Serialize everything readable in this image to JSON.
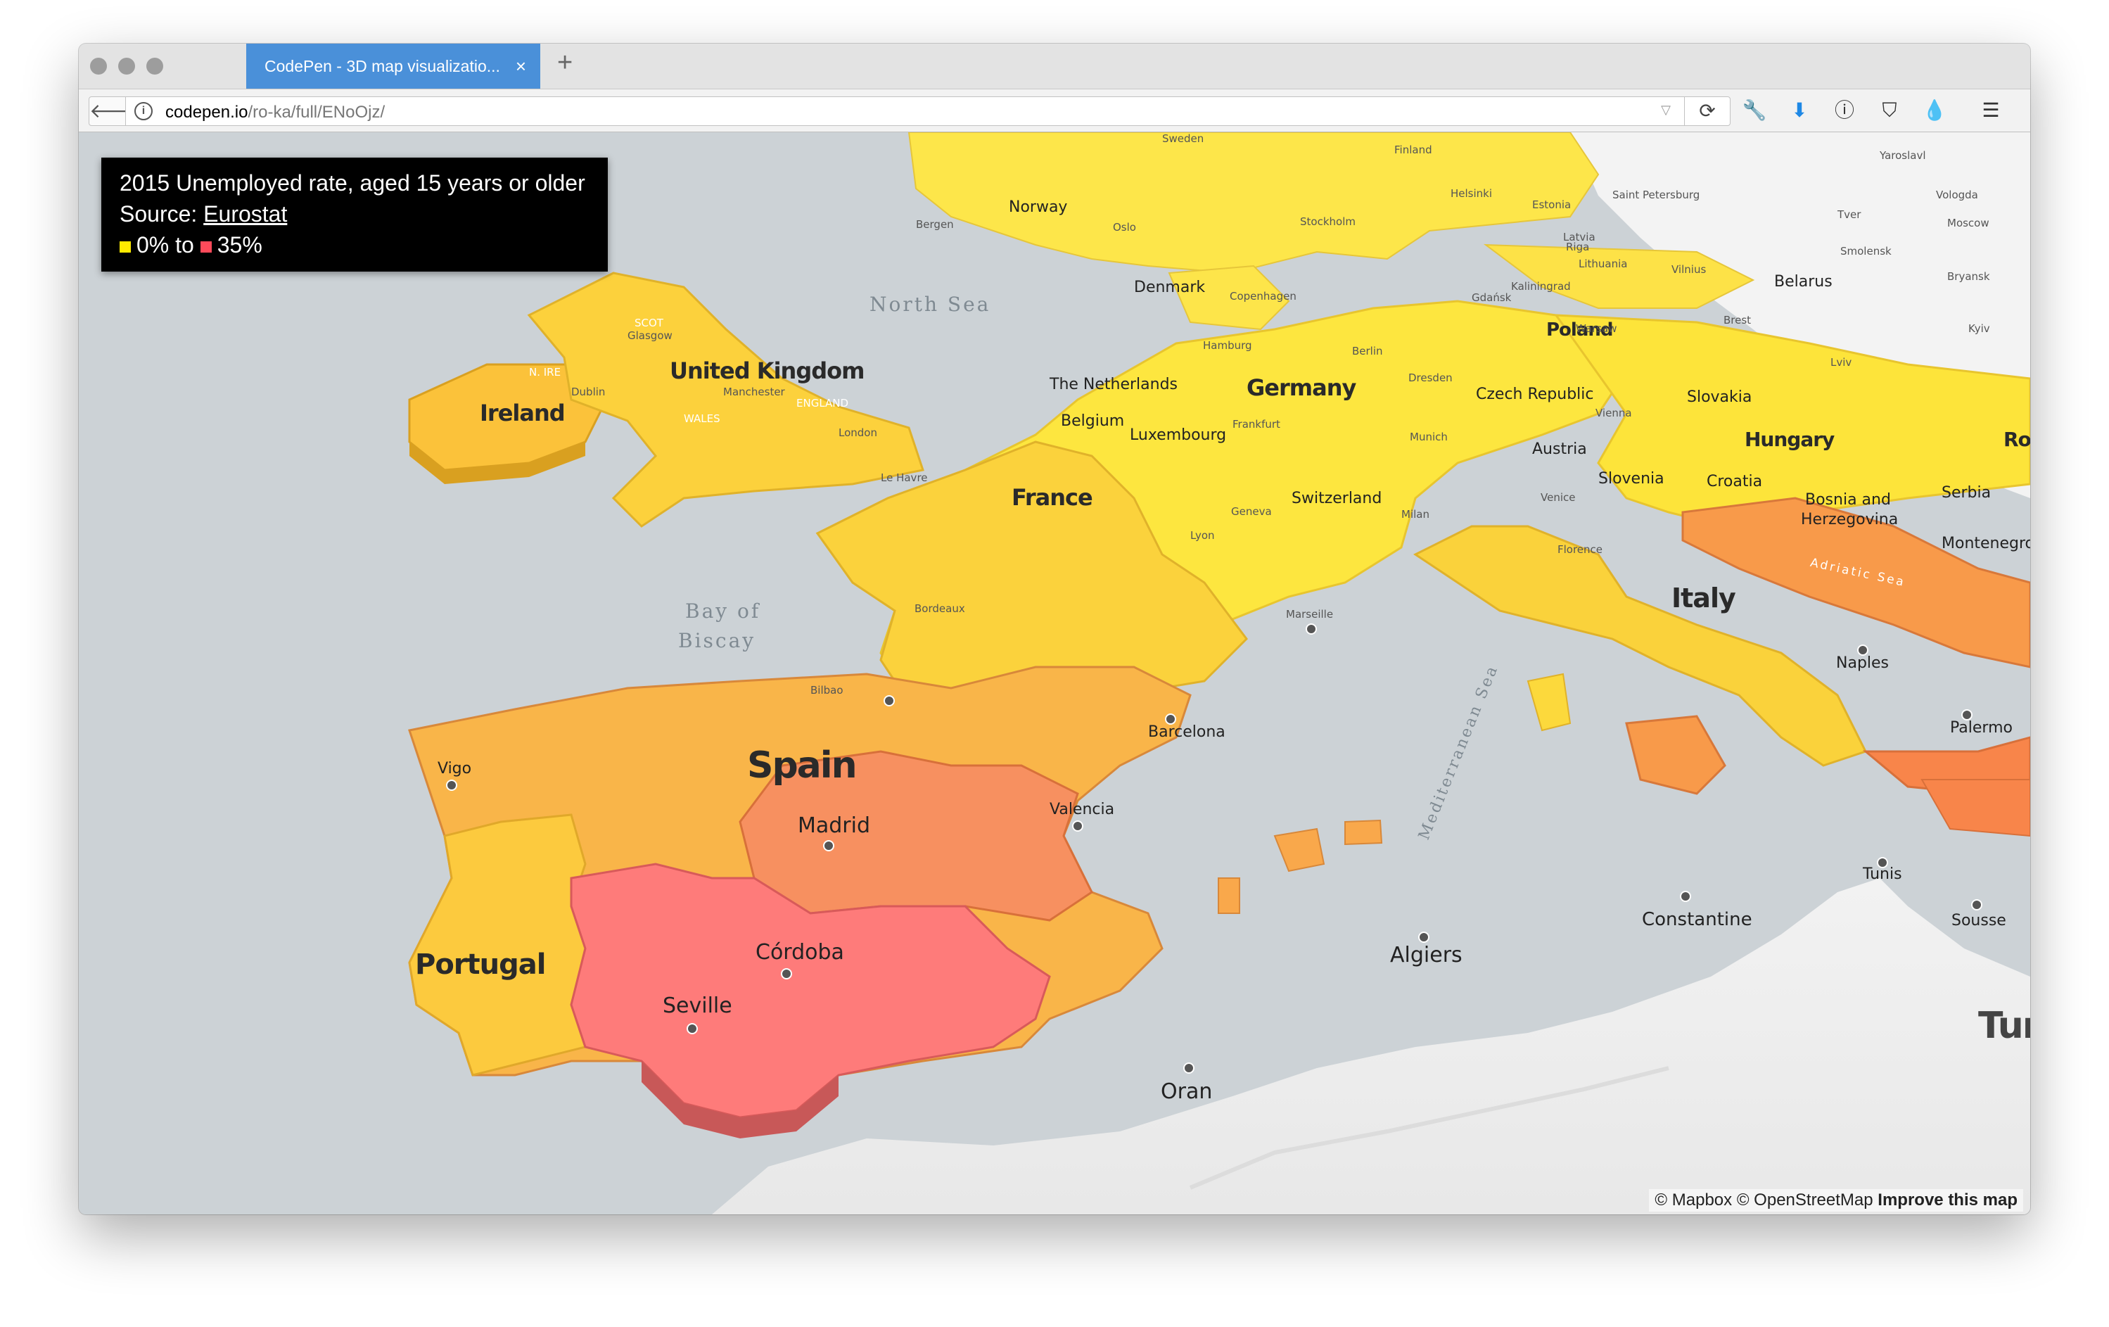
{
  "browser": {
    "tab_title": "CodePen - 3D map visualizatio...",
    "tab_close": "×",
    "new_tab": "+",
    "url_host": "codepen.io",
    "url_path": "/ro-ka/full/ENoOjz/",
    "back": "🡐",
    "info": "i",
    "dropdown": "▽",
    "reload": "⟳",
    "toolbar_icons": [
      {
        "name": "wrench-icon",
        "glyph": "🔧"
      },
      {
        "name": "download-icon",
        "glyph": "⬇"
      },
      {
        "name": "onepassword-icon",
        "glyph": "ⓘ"
      },
      {
        "name": "ublock-icon",
        "glyph": "⛉"
      },
      {
        "name": "drop-icon",
        "glyph": "💧"
      },
      {
        "name": "menu-icon",
        "glyph": "☰"
      }
    ]
  },
  "legend": {
    "title": "2015 Unemployed rate, aged 15 years or older",
    "source_label": "Source: ",
    "source_link": "Eurostat",
    "range_min": "0% to",
    "range_max": "35%",
    "color_min": "#ffea00",
    "color_max": "#ff4a5a"
  },
  "attribution": {
    "mapbox": "© Mapbox",
    "osm": "© OpenStreetMap",
    "improve": "Improve this map"
  },
  "map_labels": {
    "countries": {
      "ireland": "Ireland",
      "uk": "United Kingdom",
      "netherlands": "The Netherlands",
      "belgium": "Belgium",
      "luxembourg": "Luxembourg",
      "germany": "Germany",
      "denmark": "Denmark",
      "norway": "Norway",
      "sweden": "Sweden",
      "finland": "Finland",
      "estonia": "Estonia",
      "latvia": "Latvia",
      "lithuania": "Lithuania",
      "belarus": "Belarus",
      "poland": "Poland",
      "czech": "Czech Republic",
      "slovakia": "Slovakia",
      "austria": "Austria",
      "hungary": "Hungary",
      "romania": "Ror",
      "switzerland": "Switzerland",
      "slovenia": "Slovenia",
      "croatia": "Croatia",
      "bosnia1": "Bosnia and",
      "bosnia2": "Herzegovina",
      "serbia": "Serbia",
      "montenegro": "Montenegro",
      "france": "France",
      "italy": "Italy",
      "spain": "Spain",
      "portugal": "Portugal",
      "tunisia": "Tur"
    },
    "seas": {
      "north_sea": "North Sea",
      "bay1": "Bay of",
      "bay2": "Biscay",
      "med": "Mediterranean Sea",
      "adriatic": "Adriatic Sea"
    },
    "cities": {
      "dublin": "Dublin",
      "glasgow": "Glasgow",
      "manchester": "Manchester",
      "london": "London",
      "lehavre": "Le Havre",
      "hamburg": "Hamburg",
      "berlin": "Berlin",
      "warsaw": "Warsaw",
      "dresden": "Dresden",
      "frankfurt": "Frankfurt",
      "munich": "Munich",
      "vienna": "Vienna",
      "geneva": "Geneva",
      "lyon": "Lyon",
      "milan": "Milan",
      "venice": "Venice",
      "florence": "Florence",
      "bordeaux": "Bordeaux",
      "marseille": "Marseille",
      "naples": "Naples",
      "palermo": "Palermo",
      "bilbao": "Bilbao",
      "barcelona": "Barcelona",
      "vigo": "Vigo",
      "madrid": "Madrid",
      "valencia": "Valencia",
      "cordoba": "Córdoba",
      "seville": "Seville",
      "algiers": "Algiers",
      "oran": "Oran",
      "constantine": "Constantine",
      "tunis": "Tunis",
      "sousse": "Sousse",
      "copenhagen": "Copenhagen",
      "riga": "Riga",
      "moscow": "Moscow",
      "kyiv": "Kyiv",
      "smolensk": "Smolensk",
      "helsinki": "Helsinki",
      "stockholm": "Stockholm",
      "oslo": "Oslo",
      "bergen": "Bergen",
      "gdansk": "Gdańsk",
      "kaliningrad": "Kaliningrad",
      "vilnius": "Vilnius",
      "lviv": "Lviv",
      "brest": "Brest",
      "saint_petersburg": "Saint Petersburg",
      "tver": "Tver",
      "yaroslavl": "Yaroslavl",
      "vologda": "Vologda",
      "bryansk": "Bryansk"
    },
    "regions": {
      "scotland": "SCOT",
      "nireland": "N. IRE",
      "wales": "WALES",
      "england": "ENGLAND"
    }
  }
}
